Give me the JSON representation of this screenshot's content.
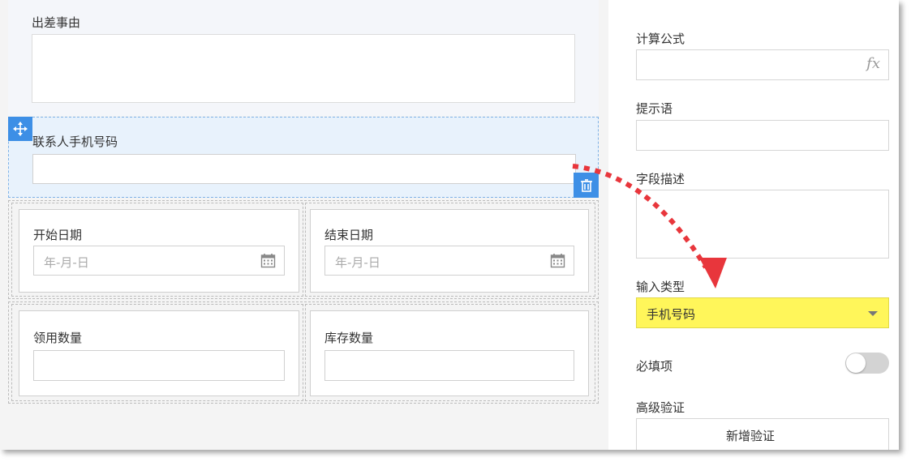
{
  "canvas": {
    "top_field_label": "出差事由",
    "selected_field_label": "联系人手机号码",
    "start_date": {
      "label": "开始日期",
      "placeholder": "年-月-日"
    },
    "end_date": {
      "label": "结束日期",
      "placeholder": "年-月-日"
    },
    "receive_qty": {
      "label": "领用数量"
    },
    "stock_qty": {
      "label": "库存数量"
    }
  },
  "properties": {
    "formula_label": "计算公式",
    "formula_icon_text": "fx",
    "hint_label": "提示语",
    "description_label": "字段描述",
    "input_type_label": "输入类型",
    "input_type_value": "手机号码",
    "required_label": "必填项",
    "required_on": false,
    "advanced_label": "高级验证",
    "advanced_button_label": "新增验证"
  },
  "colors": {
    "accent_blue": "#3d8fe6",
    "highlight_yellow": "#fff65a",
    "annotation_red": "#e8363c"
  }
}
